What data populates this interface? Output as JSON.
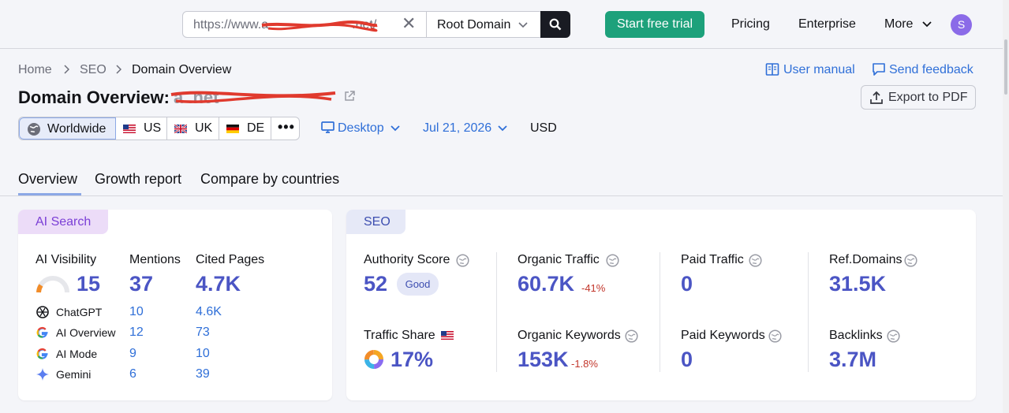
{
  "topbar": {
    "url_value": "https://www.a",
    "url_value_tail": ".net/",
    "root_select": "Root Domain",
    "trial_label": "Start free trial",
    "nav": [
      "Pricing",
      "Enterprise",
      "More"
    ],
    "avatar_letter": "S"
  },
  "breadcrumb": [
    "Home",
    "SEO",
    "Domain Overview"
  ],
  "top_links": {
    "manual": "User manual",
    "feedback": "Send feedback"
  },
  "title": {
    "prefix": "Domain Overview:",
    "domain": "a  .net"
  },
  "export_label": "Export to PDF",
  "regions": [
    "Worldwide",
    "US",
    "UK",
    "DE",
    "•••"
  ],
  "filters": {
    "device": "Desktop",
    "date": "Jul 21, 2026",
    "currency": "USD"
  },
  "tabs": [
    "Overview",
    "Growth report",
    "Compare by countries"
  ],
  "ai_card": {
    "badge": "AI Search",
    "headers": [
      "AI Visibility",
      "Mentions",
      "Cited Pages"
    ],
    "values": [
      "15",
      "37",
      "4.7K"
    ],
    "rows": [
      {
        "name": "ChatGPT",
        "mentions": "10",
        "cited": "4.6K"
      },
      {
        "name": "AI Overview",
        "mentions": "12",
        "cited": "73"
      },
      {
        "name": "AI Mode",
        "mentions": "9",
        "cited": "10"
      },
      {
        "name": "Gemini",
        "mentions": "6",
        "cited": "39"
      }
    ]
  },
  "seo_card": {
    "badge": "SEO",
    "authority": {
      "label": "Authority Score",
      "value": "52",
      "badge": "Good"
    },
    "organic_traffic": {
      "label": "Organic Traffic",
      "value": "60.7K",
      "delta": "-41%"
    },
    "paid_traffic": {
      "label": "Paid Traffic",
      "value": "0"
    },
    "ref_domains": {
      "label": "Ref.Domains",
      "value": "31.5K"
    },
    "traffic_share": {
      "label": "Traffic Share",
      "value": "17%"
    },
    "organic_keywords": {
      "label": "Organic Keywords",
      "value": "153K",
      "delta": "-1.8%"
    },
    "paid_keywords": {
      "label": "Paid Keywords",
      "value": "0"
    },
    "backlinks": {
      "label": "Backlinks",
      "value": "3.7M"
    }
  },
  "colors": {
    "accent": "#2f6fd8",
    "trial": "#1da17b",
    "metric": "#4b55c4",
    "negative": "#c2362b"
  }
}
